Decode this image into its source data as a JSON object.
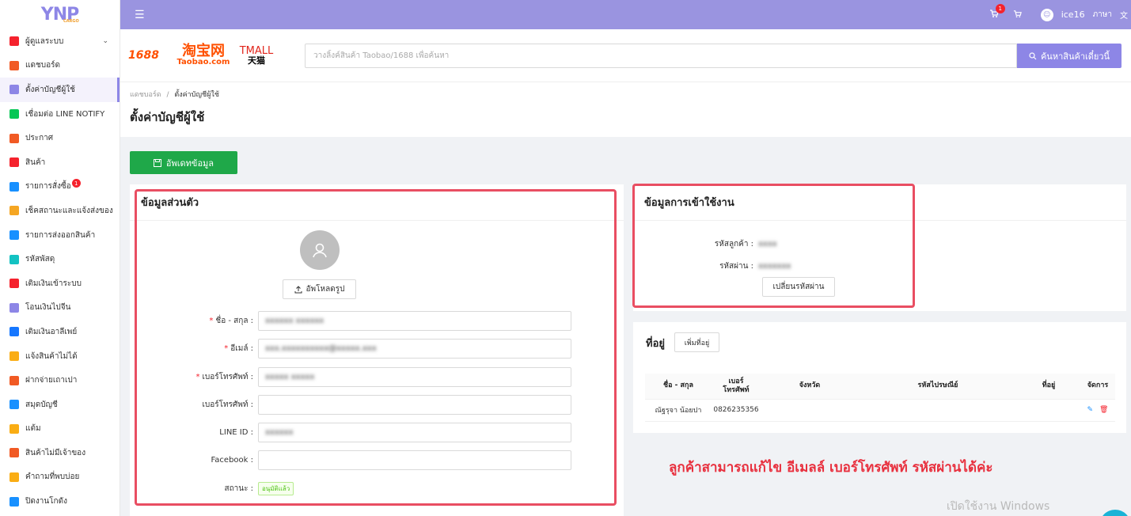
{
  "logo": {
    "text": "YNP",
    "sub": "CARGO"
  },
  "sidebar": {
    "items": [
      {
        "label": "ผู้ดูแลระบบ",
        "icon": "grid-icon",
        "icon_color": "#f5222d",
        "chevron": "⌄"
      },
      {
        "label": "แดชบอร์ด",
        "icon": "chart-icon",
        "icon_color": "#f15a24"
      },
      {
        "label": "ตั้งค่าบัญชีผู้ใช้",
        "icon": "user-settings-icon",
        "icon_color": "#8d86e6",
        "active": true
      },
      {
        "label": "เชื่อมต่อ LINE NOTIFY",
        "icon": "line-icon",
        "icon_color": "#06c755"
      },
      {
        "label": "ประกาศ",
        "icon": "megaphone-icon",
        "icon_color": "#f15a24"
      },
      {
        "label": "สินค้า",
        "icon": "box-icon",
        "icon_color": "#f5222d"
      },
      {
        "label": "รายการสั่งซื้อ",
        "icon": "cart-icon",
        "icon_color": "#1890ff",
        "badge": "1"
      },
      {
        "label": "เช็คสถานะและแจ้งส่งของ",
        "icon": "truck-icon",
        "icon_color": "#f5a623"
      },
      {
        "label": "รายการส่งออกสินค้า",
        "icon": "export-icon",
        "icon_color": "#1890ff"
      },
      {
        "label": "รหัสพัสดุ",
        "icon": "parcel-icon",
        "icon_color": "#13c2c2"
      },
      {
        "label": "เติมเงินเข้าระบบ",
        "icon": "wallet-icon",
        "icon_color": "#f5222d"
      },
      {
        "label": "โอนเงินไปจีน",
        "icon": "yuan-icon",
        "icon_color": "#8d86e6"
      },
      {
        "label": "เติมเงินอาลีเพย์",
        "icon": "alipay-icon",
        "icon_color": "#1677ff"
      },
      {
        "label": "แจ้งสินค้าไม่ได้",
        "icon": "warning-icon",
        "icon_color": "#faad14"
      },
      {
        "label": "ฝากจ่ายเถาเปา",
        "icon": "pay-icon",
        "icon_color": "#f15a24"
      },
      {
        "label": "สมุดบัญชี",
        "icon": "book-icon",
        "icon_color": "#1890ff"
      },
      {
        "label": "แต้ม",
        "icon": "coin-icon",
        "icon_color": "#faad14"
      },
      {
        "label": "สินค้าไม่มีเจ้าของ",
        "icon": "unknown-box-icon",
        "icon_color": "#f15a24"
      },
      {
        "label": "คำถามที่พบบ่อย",
        "icon": "question-icon",
        "icon_color": "#faad14"
      },
      {
        "label": "ปิดงานโกดัง",
        "icon": "warehouse-icon",
        "icon_color": "#1890ff"
      }
    ]
  },
  "topbar": {
    "menu_icon": "☰",
    "cart_badge": "1",
    "username": "ice16",
    "language": "ภาษา"
  },
  "search": {
    "brands": {
      "b1688": "1688",
      "taobao_cn": "淘宝网",
      "taobao_en": "Taobao.com",
      "tmall": "TMALL",
      "tmall_cn": "天猫"
    },
    "placeholder": "วางลิ้งค์สินค้า Taobao/1688 เพื่อค้นหา",
    "button_label": "ค้นหาสินค้าเดี๋ยวนี้"
  },
  "breadcrumb": {
    "parent": "แดชบอร์ด",
    "separator": "/",
    "current": "ตั้งค่าบัญชีผู้ใช้"
  },
  "page_title": "ตั้งค่าบัญชีผู้ใช้",
  "update_button": "อัพเดทข้อมูล",
  "personal": {
    "title": "ข้อมูลส่วนตัว",
    "upload_label": "อัพโหลดรูป",
    "fields": [
      {
        "label": "ชื่อ - สกุล :",
        "required": true,
        "value": "xxxxxx xxxxxx"
      },
      {
        "label": "อีเมล์ :",
        "required": true,
        "value": "xxx.xxxxxxxxxx@xxxxx.xxx"
      },
      {
        "label": "เบอร์โทรศัพท์ :",
        "required": true,
        "value": "xxxxx xxxxx"
      },
      {
        "label": "เบอร์โทรศัพท์ :",
        "required": false,
        "value": ""
      },
      {
        "label": "LINE ID :",
        "required": false,
        "value": "xxxxxx"
      },
      {
        "label": "Facebook :",
        "required": false,
        "value": ""
      }
    ],
    "status_label": "สถานะ :",
    "status_value": "อนุมัติแล้ว"
  },
  "login": {
    "title": "ข้อมูลการเข้าใช้งาน",
    "customer_code_label": "รหัสลูกค้า :",
    "customer_code_value": "xxxx",
    "password_label": "รหัสผ่าน :",
    "password_value": "xxxxxxx",
    "change_password_button": "เปลี่ยนรหัสผ่าน"
  },
  "address": {
    "title": "ที่อยู่",
    "add_button": "เพิ่มที่อยู่",
    "columns": [
      "ชื่อ - สกุล",
      "เบอร์\nโทรศัพท์",
      "จังหวัด",
      "รหัสไปรษณีย์",
      "ที่อยู่",
      "จัดการ"
    ],
    "rows": [
      {
        "name": "ณัฐรุจา น้อยปา",
        "phone": "0826235356",
        "province": "",
        "postal": "",
        "address": ""
      }
    ]
  },
  "annotation_note": "ลูกค้าสามารถแก้ไข อีเมลล์ เบอร์โทรศัพท์ รหัสผ่านได้ค่ะ",
  "windows_watermark": "เปิดใช้งาน Windows",
  "colors": {
    "brand": "#8d86e6",
    "topbar": "#9a94e0",
    "update": "#1fa849",
    "highlight": "#e94e62",
    "note": "#e8303e"
  }
}
